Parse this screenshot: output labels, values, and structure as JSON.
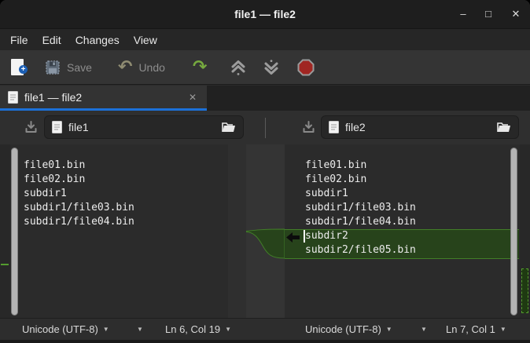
{
  "titlebar": {
    "title": "file1 — file2",
    "minimize_glyph": "–",
    "maximize_glyph": "□",
    "close_glyph": "✕"
  },
  "menubar": {
    "items": [
      "File",
      "Edit",
      "Changes",
      "View"
    ]
  },
  "toolbar": {
    "save_label": "Save",
    "undo_label": "Undo",
    "undo_glyph": "↶",
    "redo_glyph": "↷",
    "new_badge_glyph": "+"
  },
  "tabbar": {
    "tab_title": "file1 — file2",
    "close_glyph": "✕"
  },
  "headers": {
    "left_file": "file1",
    "right_file": "file2"
  },
  "editors": {
    "left_lines": [
      "file01.bin",
      "file02.bin",
      "subdir1",
      "subdir1/file03.bin",
      "subdir1/file04.bin"
    ],
    "right_lines": [
      "file01.bin",
      "file02.bin",
      "subdir1",
      "subdir1/file03.bin",
      "subdir1/file04.bin",
      "subdir2",
      "subdir2/file05.bin"
    ],
    "right_inserted_lines": [
      "subdir2",
      "subdir2/file05.bin"
    ]
  },
  "statusbar": {
    "left": {
      "encoding": "Unicode (UTF-8)",
      "position": "Ln 6, Col 19",
      "caret": "▼"
    },
    "right": {
      "encoding": "Unicode (UTF-8)",
      "position": "Ln 7, Col 1",
      "caret": "▼"
    }
  },
  "colors": {
    "accent_blue": "#1c71d8",
    "diff_insert_fill": "#27431b",
    "diff_insert_border": "#427f28",
    "map_chunk_border": "#549c2e",
    "scrollbar_thumb": "#b4b4b4",
    "stop_red": "#a02622",
    "redo_green": "#76a93f"
  }
}
